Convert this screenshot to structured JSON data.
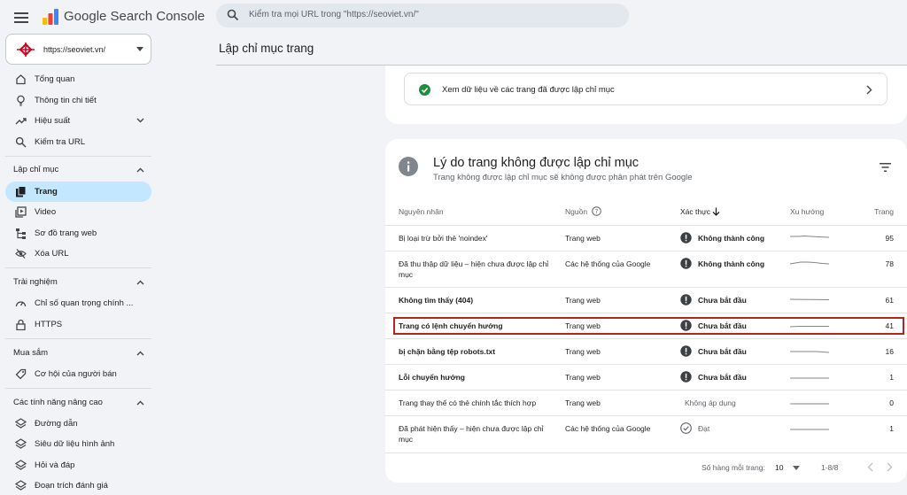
{
  "app": {
    "title": "Google Search Console"
  },
  "search": {
    "placeholder": "Kiểm tra mọi URL trong \"https://seoviet.vn/\""
  },
  "property": {
    "value": "https://seoviet.vn/"
  },
  "sidebar": {
    "top_items": [
      {
        "label": "Tổng quan",
        "icon": "home-icon"
      },
      {
        "label": "Thông tin chi tiết",
        "icon": "lightbulb-icon"
      },
      {
        "label": "Hiệu suất",
        "icon": "trending-up-icon"
      },
      {
        "label": "Kiểm tra URL",
        "icon": "search-icon"
      }
    ],
    "sections": [
      {
        "label": "Lập chỉ mục",
        "items": [
          {
            "label": "Trang",
            "icon": "pages-icon",
            "active": true
          },
          {
            "label": "Video",
            "icon": "video-icon"
          },
          {
            "label": "Sơ đồ trang web",
            "icon": "sitemap-icon"
          },
          {
            "label": "Xóa URL",
            "icon": "visibility-off-icon"
          }
        ]
      },
      {
        "label": "Trải nghiệm",
        "items": [
          {
            "label": "Chỉ số quan trọng chính ...",
            "icon": "speed-icon"
          },
          {
            "label": "HTTPS",
            "icon": "lock-icon"
          }
        ]
      },
      {
        "label": "Mua sắm",
        "items": [
          {
            "label": "Cơ hội của người bán",
            "icon": "tag-icon"
          }
        ]
      },
      {
        "label": "Các tính năng nâng cao",
        "items": [
          {
            "label": "Đường dẫn",
            "icon": "layers-icon"
          },
          {
            "label": "Siêu dữ liệu hình ảnh",
            "icon": "layers-icon"
          },
          {
            "label": "Hỏi và đáp",
            "icon": "layers-icon"
          },
          {
            "label": "Đoạn trích đánh giá",
            "icon": "layers-icon"
          }
        ]
      }
    ]
  },
  "main": {
    "page_title": "Lập chỉ mục trang",
    "indexed_link": "Xem dữ liệu về các trang đã được lập chỉ mục",
    "card": {
      "title": "Lý do trang không được lập chỉ mục",
      "subtitle": "Trang không được lập chỉ mục sẽ không được phân phát trên Google"
    },
    "table": {
      "headers": {
        "reason": "Nguyên nhân",
        "source": "Nguồn",
        "validation": "Xác thực",
        "trend": "Xu hướng",
        "pages": "Trang"
      },
      "rows": [
        {
          "reason": "Bị loại trừ bởi thẻ 'noindex'",
          "source": "Trang web",
          "status": "Không thành công",
          "status_type": "error",
          "pages": "95",
          "bold": false,
          "highlighted": false
        },
        {
          "reason": "Đã thu thập dữ liệu – hiện chưa được lập chỉ mục",
          "source": "Các hệ thống của Google",
          "status": "Không thành công",
          "status_type": "error",
          "pages": "78",
          "bold": false,
          "highlighted": false
        },
        {
          "reason": "Không tìm thấy (404)",
          "source": "Trang web",
          "status": "Chưa bắt đầu",
          "status_type": "error",
          "pages": "61",
          "bold": true,
          "highlighted": false
        },
        {
          "reason": "Trang có lệnh chuyển hướng",
          "source": "Trang web",
          "status": "Chưa bắt đầu",
          "status_type": "error",
          "pages": "41",
          "bold": true,
          "highlighted": true
        },
        {
          "reason": "bị chặn bằng tệp robots.txt",
          "source": "Trang web",
          "status": "Chưa bắt đầu",
          "status_type": "error",
          "pages": "16",
          "bold": true,
          "highlighted": false
        },
        {
          "reason": "Lỗi chuyển hướng",
          "source": "Trang web",
          "status": "Chưa bắt đầu",
          "status_type": "error",
          "pages": "1",
          "bold": true,
          "highlighted": false
        },
        {
          "reason": "Trang thay thế có thẻ chính tắc thích hợp",
          "source": "Trang web",
          "status": "Không áp dụng",
          "status_type": "na",
          "pages": "0",
          "bold": false,
          "highlighted": false
        },
        {
          "reason": "Đã phát hiện thấy – hiện chưa được lập chỉ mục",
          "source": "Các hệ thống của Google",
          "status": "Đạt",
          "status_type": "passed",
          "pages": "1",
          "bold": false,
          "highlighted": false
        }
      ]
    },
    "pager": {
      "rows_label": "Số hàng mỗi trang:",
      "rows_value": "10",
      "range": "1-8/8"
    }
  }
}
